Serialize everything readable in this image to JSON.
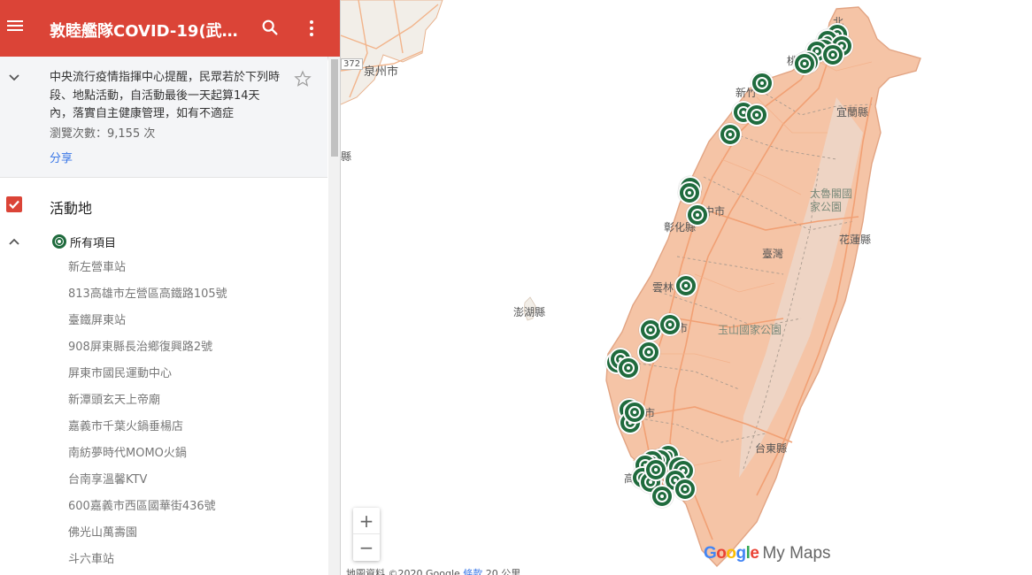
{
  "header": {
    "title": "敦睦艦隊COVID-19(武…",
    "color": "#db4437"
  },
  "info": {
    "description": "中央流行疫情指揮中心提醒，民眾若於下列時段、地點活動，自活動最後一天起算14天內，落實自主健康管理，如有不適症",
    "views": "瀏覽次數：9,155 次",
    "share": "分享"
  },
  "layer": {
    "title": "活動地",
    "checked": true,
    "group_label": "所有項目",
    "items": [
      "新左營車站",
      "813高雄市左營區高鐵路105號",
      "臺鐵屏東站",
      "908屏東縣長治鄉復興路2號",
      "屏東市國民運動中心",
      "新潭頭玄天上帝廟",
      "嘉義市千葉火鍋垂楊店",
      "南紡夢時代MOMO火鍋",
      "台南享溫馨KTV",
      "600嘉義市西區國華街436號",
      "佛光山萬壽園",
      "斗六車站"
    ]
  },
  "map": {
    "labels": {
      "north": "北",
      "taoyuan": "桃",
      "hsinchu": "新竹",
      "yilan": "宜蘭縣",
      "taroko": "太魯閣國家公園",
      "taichung": "中市",
      "changhua": "彰化縣",
      "hualien": "花蓮縣",
      "nantou": "臺灣",
      "yunlin": "雲林",
      "penghu": "澎湖縣",
      "yushan": "玉山國家公園",
      "chiayi": "市",
      "tainan": "台南市",
      "taitung": "台東縣",
      "kaohsiung": "高",
      "quanzhou": "泉州市",
      "county_left": "縣",
      "road": "372"
    },
    "zoom_in": "+",
    "zoom_out": "−",
    "brand_google": "Google",
    "brand_mymaps": "My Maps",
    "attribution": "地圖資料 ©2020 Google",
    "terms": "條款",
    "scale": "20 公里"
  }
}
